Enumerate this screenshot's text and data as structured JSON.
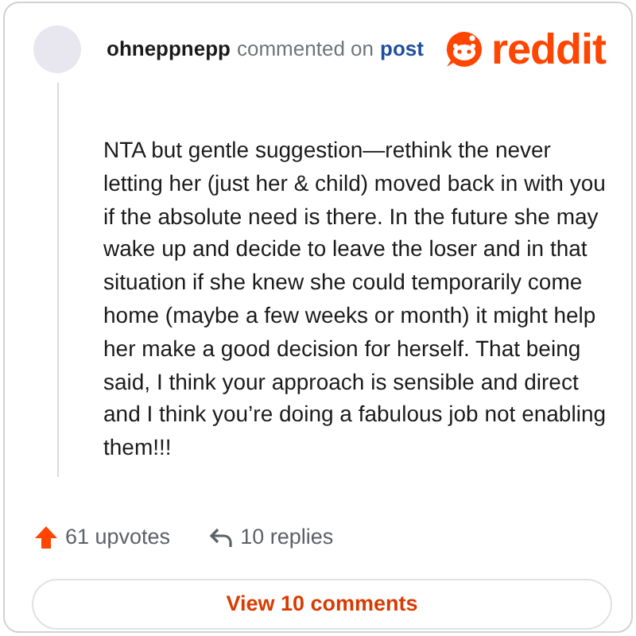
{
  "header": {
    "username": "ohneppnepp",
    "action": "commented on",
    "link": "post",
    "logo_text": "reddit"
  },
  "comment": "NTA but gentle suggestion—rethink the never letting her (just her & child) moved back in with you if the absolute need is there. In the future she may wake up and decide to leave the loser and in that situation if she knew she could temporarily come home (maybe a few weeks or month) it might help her make a good decision for herself. That being said, I think your approach is sensible and direct and I think you’re doing a fabulous job not enabling them!!!",
  "stats": {
    "upvotes": "61 upvotes",
    "replies": "10 replies"
  },
  "button": "View 10 comments"
}
